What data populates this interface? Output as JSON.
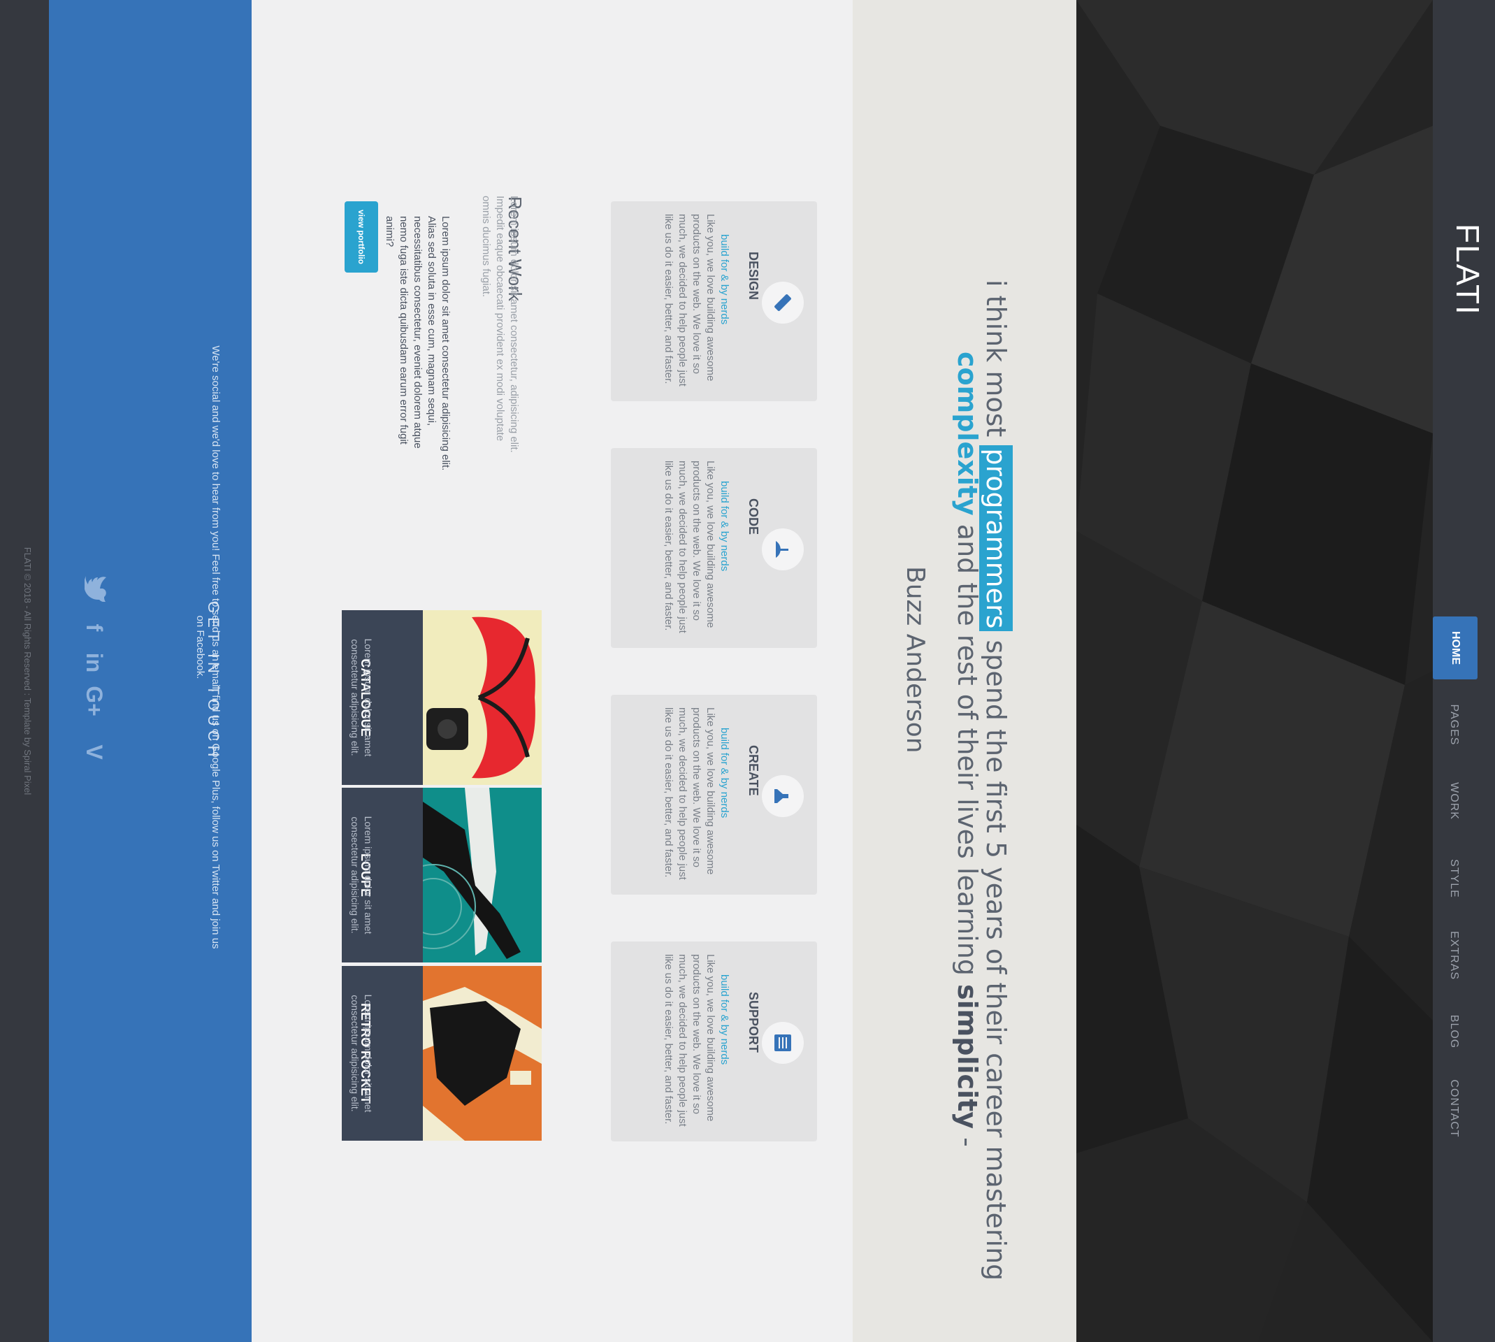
{
  "nav": {
    "brand": "FLATI",
    "items": [
      "HOME",
      "PAGES",
      "WORK",
      "STYLE",
      "EXTRAS",
      "BLOG",
      "CONTACT"
    ],
    "active": "HOME"
  },
  "quote": {
    "line1_pre": "i think most ",
    "line1_hl": "programmers",
    "line1_post": " spend the first 5 years of their career mastering",
    "line2_blue": "complexity",
    "line2_mid": " and the rest of their lives learning ",
    "line2_dark": "simplicity",
    "line2_end": " -",
    "author": "Buzz Anderson"
  },
  "services": [
    {
      "title": "DESIGN",
      "icon": "pencil-icon",
      "sub": "build for & by nerds",
      "body": "Like you, we love building awesome products on the web. We love it so much, we decided to help people just like us do it easier, better, and faster."
    },
    {
      "title": "CODE",
      "icon": "umbrella-icon",
      "sub": "build for & by nerds",
      "body": "Like you, we love building awesome products on the web. We love it so much, we decided to help people just like us do it easier, better, and faster."
    },
    {
      "title": "CREATE",
      "icon": "flask-icon",
      "sub": "build for & by nerds",
      "body": "Like you, we love building awesome products on the web. We love it so much, we decided to help people just like us do it easier, better, and faster."
    },
    {
      "title": "SUPPORT",
      "icon": "book-icon",
      "sub": "build for & by nerds",
      "body": "Like you, we love building awesome products on the web. We love it so much, we decided to help people just like us do it easier, better, and faster."
    }
  ],
  "recent_work": {
    "title": "Recent Work",
    "p1": "Lorem ipsum dolor sit amet consectetur, adipisicing elit. Impedit eaque obcaecati provident ex modi voluptate omnis ducimus fugiat.",
    "p2": "Lorem ipsum dolor sit amet consectetur adipisicing elit. Alias sed soluta in esse cum, magnam sequi, necessitatibus consectetur, eveniet dolorem atque nemo fuga iste dicta quibusdam earum error fugit animi?",
    "button": "view portfolio"
  },
  "portfolio": [
    {
      "title": "CATALOGUE",
      "text": "Lorem ipsum dolor sit amet consectetur adipisicing elit."
    },
    {
      "title": "LOUPE",
      "text": "Lorem ipsum dolor sit amet consectetur adipisicing elit."
    },
    {
      "title": "RETRO ROCKET",
      "text": "Lorem ipsum dolor sit amet consectetur adipisicing elit."
    }
  ],
  "contact": {
    "title": "GET IN TOUCH",
    "text": "We're social and we'd love to hear from you! Feel free to send us an email, find us on Google Plus, follow us on Twitter and join us on Facebook.",
    "socials": [
      "twitter-icon",
      "facebook-icon",
      "linkedin-icon",
      "google-plus-icon",
      "vimeo-icon"
    ]
  },
  "footer": {
    "text": "FLATI © 2018 - All Rights Reserved : Template by Spiral Pixel"
  },
  "colors": {
    "accent": "#2aa3cf",
    "primary_blue": "#3673b8",
    "dark_bg": "#35383f"
  }
}
